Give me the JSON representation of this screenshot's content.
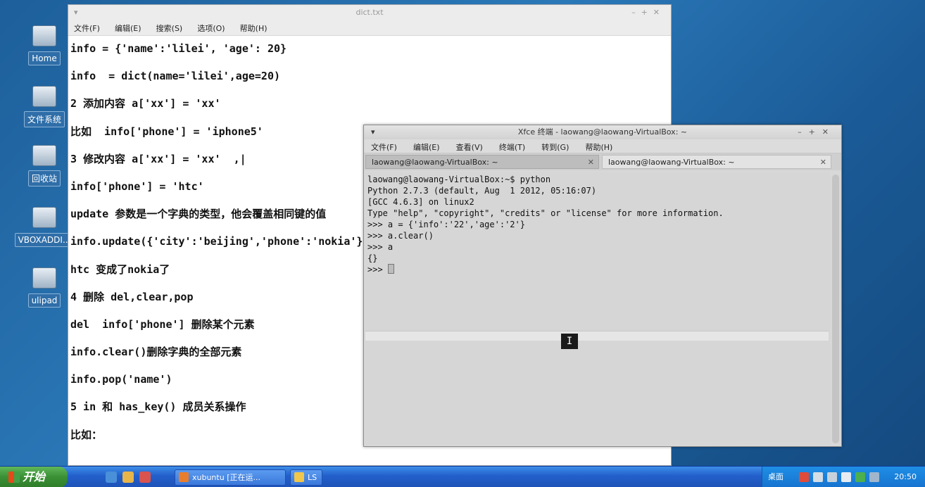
{
  "desktop": {
    "icons": [
      {
        "label": "Home",
        "icon": "home-folder-icon"
      },
      {
        "label": "文件系统",
        "icon": "filesystem-drive-icon"
      },
      {
        "label": "回收站",
        "icon": "trash-icon"
      },
      {
        "label": "VBOXADDI...",
        "icon": "cdrom-icon"
      },
      {
        "label": "ulipad",
        "icon": "ulipad-app-icon"
      }
    ]
  },
  "editor": {
    "title": "dict.txt",
    "menus": [
      "文件(F)",
      "编辑(E)",
      "搜索(S)",
      "选项(O)",
      "帮助(H)"
    ],
    "lines": [
      "info = {'name':'lilei', 'age': 20}",
      "info  = dict(name='lilei',age=20)",
      "2 添加内容 a['xx'] = 'xx'",
      "比如  info['phone'] = 'iphone5'",
      "3 修改内容 a['xx'] = 'xx'  ,|",
      "info['phone'] = 'htc'",
      "update 参数是一个字典的类型，他会覆盖相同键的值",
      "info.update({'city':'beijing','phone':'nokia'})",
      "htc 变成了nokia了",
      "4 删除 del,clear,pop",
      "del  info['phone'] 删除某个元素",
      "info.clear()删除字典的全部元素",
      "info.pop('name')",
      "5 in 和 has_key() 成员关系操作",
      "比如："
    ]
  },
  "terminal": {
    "title": "Xfce 终端 - laowang@laowang-VirtualBox: ~",
    "menus": [
      "文件(F)",
      "编辑(E)",
      "查看(V)",
      "终端(T)",
      "转到(G)",
      "帮助(H)"
    ],
    "tabs": [
      {
        "label": "laowang@laowang-VirtualBox: ~"
      },
      {
        "label": "laowang@laowang-VirtualBox: ~"
      }
    ],
    "lines": [
      "laowang@laowang-VirtualBox:~$ python",
      "Python 2.7.3 (default, Aug  1 2012, 05:16:07)",
      "[GCC 4.6.3] on linux2",
      "Type \"help\", \"copyright\", \"credits\" or \"license\" for more information.",
      ">>> a = {'info':'22','age':'2'}",
      ">>> a.clear()",
      ">>> a",
      "{}"
    ],
    "prompt": ">>> "
  },
  "taskbar": {
    "start_label": "开始",
    "tasks": [
      {
        "label": "xubuntu [正在运..."
      },
      {
        "label": "LS"
      }
    ],
    "desktop_label": "桌面",
    "clock": "20:50"
  }
}
